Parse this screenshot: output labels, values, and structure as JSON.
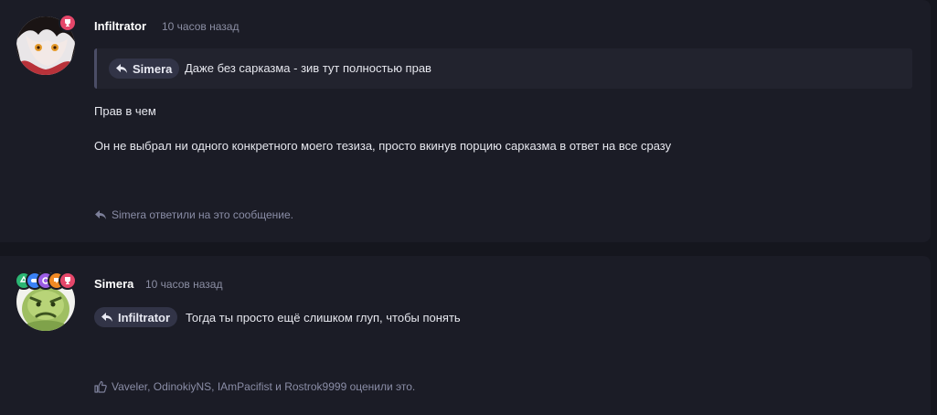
{
  "posts": [
    {
      "author": "Infiltrator",
      "time": "10 часов назад",
      "quote": {
        "mention": "Simera",
        "text": "Даже без сарказма - зив тут полностью прав"
      },
      "paragraphs": [
        "Прав в чем",
        "Он не выбрал ни одного конкретного моего тезиза, просто вкинув порцию сарказма в ответ на все сразу"
      ],
      "footer": "Simera ответили на это сообщение.",
      "footer_icon": "reply-icon",
      "badges": [
        {
          "icon": "trophy-icon",
          "color": "#e5476a"
        }
      ]
    },
    {
      "author": "Simera",
      "time": "10 часов назад",
      "mention": "Infiltrator",
      "text": "Тогда ты просто ещё слишком глуп, чтобы понять",
      "footer": "Vaveler, OdinokiyNS, IAmPacifist и Rostrok9999 оценили это.",
      "footer_icon": "thumbs-up-icon",
      "badges": [
        {
          "icon": "recycle-icon",
          "color": "#2bb673"
        },
        {
          "icon": "gamepad-icon",
          "color": "#3b82f6"
        },
        {
          "icon": "gear-icon",
          "color": "#9b5de5"
        },
        {
          "icon": "controller-icon",
          "color": "#f08a24"
        },
        {
          "icon": "trophy-icon",
          "color": "#e5476a"
        }
      ]
    }
  ],
  "colors": {
    "background": "#15161e",
    "card": "#1b1c26",
    "quote_bg": "#22232e",
    "mention_bg": "#323447",
    "muted_text": "#8a8da6"
  }
}
